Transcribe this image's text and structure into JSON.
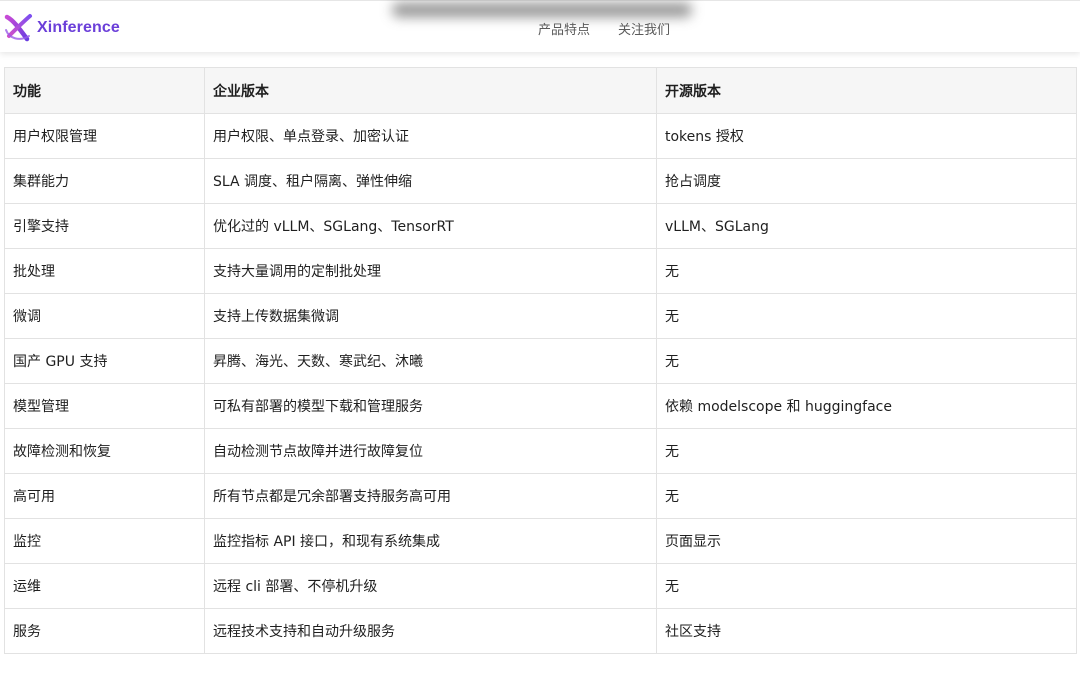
{
  "brand": {
    "name": "Xinference",
    "icon": "xinference-logo-icon"
  },
  "nav": {
    "links": [
      "产品特点",
      "关注我们"
    ]
  },
  "table": {
    "headers": [
      "功能",
      "企业版本",
      "开源版本"
    ],
    "rows": [
      [
        "用户权限管理",
        "用户权限、单点登录、加密认证",
        "tokens 授权"
      ],
      [
        "集群能力",
        "SLA 调度、租户隔离、弹性伸缩",
        "抢占调度"
      ],
      [
        "引擎支持",
        "优化过的 vLLM、SGLang、TensorRT",
        "vLLM、SGLang"
      ],
      [
        "批处理",
        "支持大量调用的定制批处理",
        "无"
      ],
      [
        "微调",
        "支持上传数据集微调",
        "无"
      ],
      [
        "国产 GPU 支持",
        "昇腾、海光、天数、寒武纪、沐曦",
        "无"
      ],
      [
        "模型管理",
        "可私有部署的模型下载和管理服务",
        "依赖 modelscope 和 huggingface"
      ],
      [
        "故障检测和恢复",
        "自动检测节点故障并进行故障复位",
        "无"
      ],
      [
        "高可用",
        "所有节点都是冗余部署支持服务高可用",
        "无"
      ],
      [
        "监控",
        "监控指标 API 接口，和现有系统集成",
        "页面显示"
      ],
      [
        "运维",
        "远程 cli 部署、不停机升级",
        "无"
      ],
      [
        "服务",
        "远程技术支持和自动升级服务",
        "社区支持"
      ]
    ]
  },
  "colors": {
    "brand": "#6b3fd9",
    "border": "#e2e2e2",
    "header_bg": "#f6f6f6",
    "text": "#1f1f1f"
  }
}
